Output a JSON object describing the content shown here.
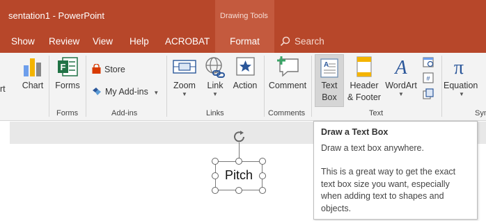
{
  "window": {
    "title": "sentation1  -  PowerPoint",
    "context_label": "Drawing Tools"
  },
  "tabs": [
    {
      "label": "Show"
    },
    {
      "label": "Review"
    },
    {
      "label": "View"
    },
    {
      "label": "Help"
    },
    {
      "label": "ACROBAT"
    },
    {
      "label": "Format"
    }
  ],
  "search": {
    "label": "Search"
  },
  "ribbon": {
    "art_partial": "rt",
    "chart": "Chart",
    "forms": "Forms",
    "group_forms": "Forms",
    "store": "Store",
    "my_addins": "My Add-ins",
    "group_addins": "Add-ins",
    "zoom": "Zoom",
    "link": "Link",
    "action": "Action",
    "group_links": "Links",
    "comment": "Comment",
    "group_comments": "Comments",
    "textbox_line1": "Text",
    "textbox_line2": "Box",
    "header_line1": "Header",
    "header_line2": "& Footer",
    "wordart": "WordArt",
    "group_text": "Text",
    "equation": "Equation",
    "group_symbols_partial": "Sym"
  },
  "slide": {
    "textbox_text": "Pitch"
  },
  "tooltip": {
    "title": "Draw a Text Box",
    "line1": "Draw a text box anywhere.",
    "body": "This is a great way to get the exact text box size you want, especially when adding text to shapes and objects."
  },
  "colors": {
    "accent": "#b7472a",
    "context_tab": "#c45a3e",
    "ribbon_bg": "#f3f3f3",
    "excel_green": "#217346",
    "office_red": "#d83b01",
    "link_blue": "#2b579a"
  }
}
